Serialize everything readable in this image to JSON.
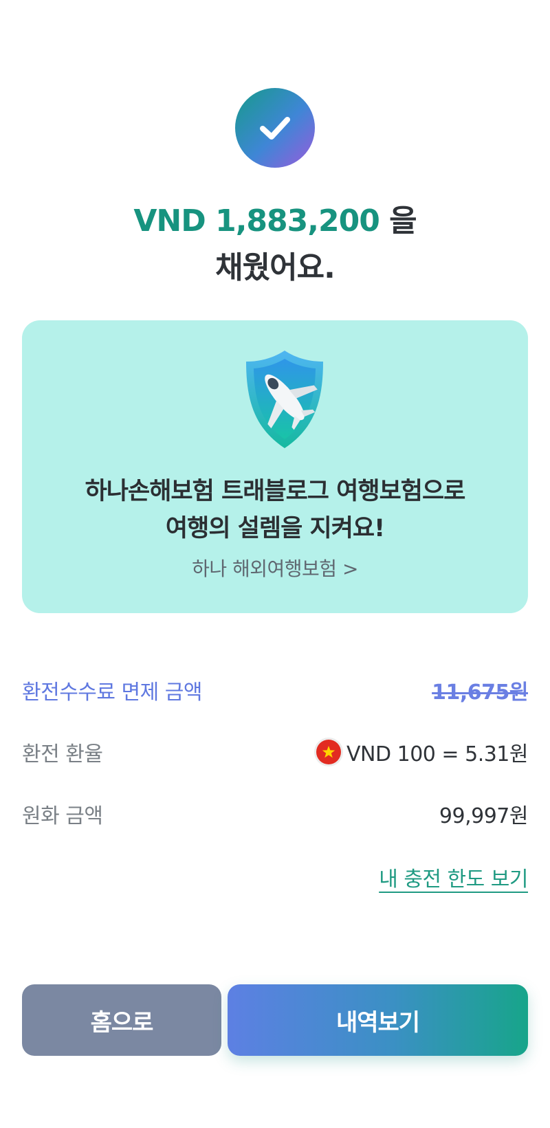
{
  "result": {
    "amount": "VND 1,883,200",
    "amount_suffix": " 을",
    "line2": "채웠어요."
  },
  "promo": {
    "icon": "shield-airplane-icon",
    "title_line1": "하나손해보험 트래블로그 여행보험으로",
    "title_line2": "여행의 설렘을 지켜요!",
    "link": "하나 해외여행보험 >"
  },
  "details": {
    "fee_label": "환전수수료 면제 금액",
    "fee_value": "11,675원",
    "rate_label": "환전 환율",
    "rate_value": "VND 100 = 5.31원",
    "krw_label": "원화 금액",
    "krw_value": "99,997원"
  },
  "limit_link": "내 충전 한도 보기",
  "buttons": {
    "home": "홈으로",
    "history": "내역보기"
  },
  "colors": {
    "accent_green": "#17937f",
    "promo_bg": "#b5f1ea",
    "fee_blue": "#5f78e0",
    "home_button": "#7b88a2"
  }
}
